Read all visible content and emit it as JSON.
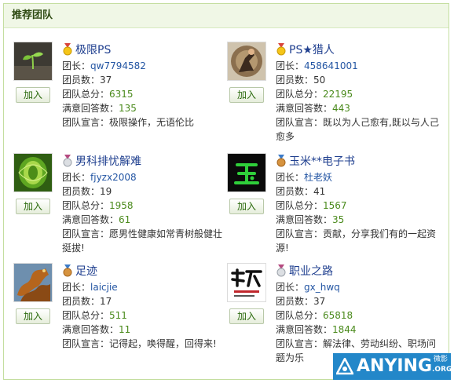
{
  "panel": {
    "title": "推荐团队"
  },
  "labels": {
    "leader": "团长：",
    "members": "团员数：",
    "score": "团队总分：",
    "satisfied": "满意回答数：",
    "motto": "团队宣言：",
    "join": "加入"
  },
  "teams": [
    {
      "name": "极限PS",
      "medal": "gold",
      "avatar": "seedling",
      "leader": "qw7794582",
      "members": "37",
      "score": "6315",
      "satisfied": "135",
      "motto": "极限操作，无语伦比"
    },
    {
      "name": "PS★猎人",
      "medal": "gold",
      "avatar": "hunter",
      "leader": "458641001",
      "members": "50",
      "score": "22195",
      "satisfied": "443",
      "motto": "既以为人己愈有,既以与人己愈多"
    },
    {
      "name": "男科排忧解难",
      "medal": "silver",
      "avatar": "green-swirl",
      "leader": "fjyzx2008",
      "members": "19",
      "score": "1958",
      "satisfied": "61",
      "motto": "愿男性健康如常青树般健壮挺拔!"
    },
    {
      "name": "玉米**电子书",
      "medal": "bronze",
      "avatar": "jade-glyph",
      "leader": "杜老妖",
      "members": "41",
      "score": "1567",
      "satisfied": "35",
      "motto": "贡献，分享我们有的一起资源!"
    },
    {
      "name": "足迹",
      "medal": "bronze",
      "avatar": "dragon",
      "leader": "laicjie",
      "members": "17",
      "score": "511",
      "satisfied": "11",
      "motto": "记得起，唤得醒，回得来!"
    },
    {
      "name": "职业之路",
      "medal": "silver",
      "avatar": "calligraphy",
      "leader": "gx_hwq",
      "members": "37",
      "score": "65818",
      "satisfied": "1844",
      "motto": "解法律、劳动纠纷、职场问题为乐"
    }
  ],
  "watermark": {
    "text": "ANYING",
    "sub": "微影",
    "org": ".ORG"
  },
  "colors": {
    "accent": "#2355a3",
    "score": "#4a8a1c",
    "header_bg": "#f0f7e6",
    "border": "#c4dea0"
  }
}
